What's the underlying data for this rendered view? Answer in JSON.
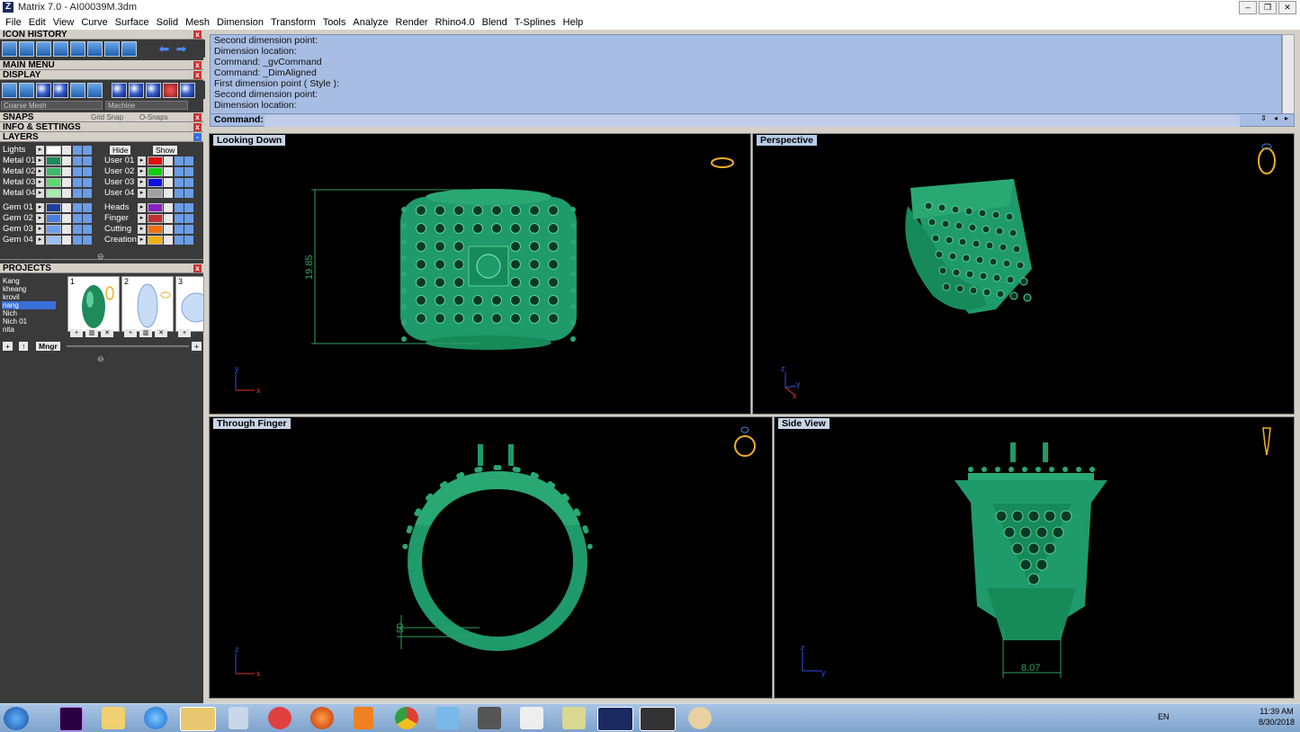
{
  "window": {
    "title": "Matrix 7.0 - AI00039M.3dm",
    "app_icon": "Z"
  },
  "menu": [
    "File",
    "Edit",
    "View",
    "Curve",
    "Surface",
    "Solid",
    "Mesh",
    "Dimension",
    "Transform",
    "Tools",
    "Analyze",
    "Render",
    "Rhino4.0",
    "Blend",
    "T-Splines",
    "Help"
  ],
  "panels": {
    "icon_history": "ICON HISTORY",
    "main_menu": "MAIN MENU",
    "display": "DISPLAY",
    "display_mesh": "Coarse Mesh",
    "display_material": "Machine",
    "snaps": "SNAPS",
    "grid_snap": "Grid Snap",
    "osnaps": "O-Snaps",
    "info_settings": "INFO & SETTINGS",
    "layers": "LAYERS",
    "projects": "PROJECTS",
    "mngr": "Mngr"
  },
  "layers": {
    "lights": "Lights",
    "hide": "Hide",
    "show": "Show",
    "left": [
      {
        "name": "Metal 01",
        "color": "#1f8a5a"
      },
      {
        "name": "Metal 02",
        "color": "#3cb96a"
      },
      {
        "name": "Metal 03",
        "color": "#5fd86f"
      },
      {
        "name": "Metal 04",
        "color": "#a8ecb0"
      },
      {
        "name": "Gem 01",
        "color": "#1f3f9a"
      },
      {
        "name": "Gem 02",
        "color": "#4a7de0"
      },
      {
        "name": "Gem 03",
        "color": "#6c9eef"
      },
      {
        "name": "Gem 04",
        "color": "#9cc0f5"
      }
    ],
    "right": [
      {
        "name": "User 01",
        "color": "#e01010"
      },
      {
        "name": "User 02",
        "color": "#10d010"
      },
      {
        "name": "User 03",
        "color": "#1010e0"
      },
      {
        "name": "User 04",
        "color": "#a0a0a0"
      },
      {
        "name": "Heads",
        "color": "#8a20c0"
      },
      {
        "name": "Finger",
        "color": "#c03030"
      },
      {
        "name": "Cutting",
        "color": "#f07010"
      },
      {
        "name": "Creation",
        "color": "#f0b010"
      }
    ]
  },
  "projects": {
    "list": [
      "Kang",
      "kheang",
      "krovil",
      "nang",
      "Nich",
      "Nich 01",
      "nita"
    ],
    "selected": "nang",
    "thumbs": [
      "1",
      "2",
      "3"
    ]
  },
  "command_history": [
    "Second dimension point:",
    "Dimension location:",
    "Command: _gvCommand",
    "Command: _DimAligned",
    "First dimension point ( Style ):",
    "Second dimension point:",
    "Dimension location:"
  ],
  "command_label": "Command:",
  "viewports": {
    "top_left": {
      "title": "Looking Down",
      "dimension": "19.85",
      "axes": [
        "y",
        "x"
      ]
    },
    "top_right": {
      "title": "Perspective",
      "axes": [
        "z",
        "y",
        "x"
      ]
    },
    "bottom_left": {
      "title": "Through Finger",
      "dimension": "50",
      "axes": [
        "z",
        "x"
      ]
    },
    "bottom_right": {
      "title": "Side View",
      "dimension": "8.07",
      "axes": [
        "z",
        "y"
      ]
    }
  },
  "colors": {
    "model": "#1f9a6a",
    "dim": "#2fa060",
    "gizmo": "#f0b020",
    "viewport_bg": "#000000"
  },
  "taskbar": {
    "apps": [
      "start-orb",
      "premiere",
      "explorer-folder",
      "ie",
      "file-explorer",
      "calculator",
      "snipping",
      "firefox",
      "media",
      "chrome",
      "app-blue",
      "wand",
      "zbrush",
      "notes",
      "matrix",
      "rhino",
      "paint"
    ],
    "lang": "EN",
    "time": "11:39 AM",
    "date": "8/30/2018"
  }
}
